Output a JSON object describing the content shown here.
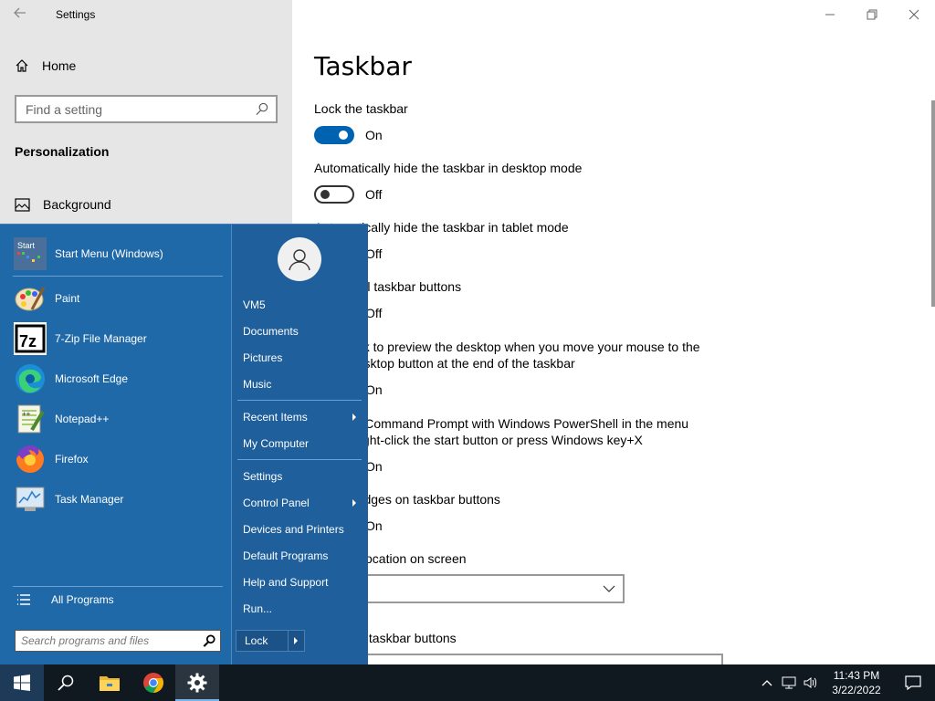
{
  "window": {
    "title": "Settings",
    "controls": {
      "minimize": "minimize",
      "maximize": "maximize",
      "close": "close"
    }
  },
  "sidebar": {
    "home_label": "Home",
    "search_placeholder": "Find a setting",
    "section_title": "Personalization",
    "items": [
      {
        "label": "Background",
        "icon": "picture-icon"
      }
    ]
  },
  "content": {
    "page_title": "Taskbar",
    "settings": [
      {
        "label": "Lock the taskbar",
        "state": "On"
      },
      {
        "label": "Automatically hide the taskbar in desktop mode",
        "state": "Off"
      },
      {
        "label": "Automatically hide the taskbar in tablet mode",
        "state": "Off"
      },
      {
        "label": "Use small taskbar buttons",
        "state": "Off"
      },
      {
        "label": "Use Peek to preview the desktop when you move your mouse to the Show desktop button at the end of the taskbar",
        "state": "On"
      },
      {
        "label": "Replace Command Prompt with Windows PowerShell in the menu when I right-click the start button or press Windows key+X",
        "state": "On"
      },
      {
        "label": "Show badges on taskbar buttons",
        "state": "On"
      },
      {
        "label": "Taskbar location on screen",
        "value": ""
      },
      {
        "label": "Combine taskbar buttons",
        "value": ""
      }
    ]
  },
  "start_menu": {
    "pinned": [
      {
        "label": "Start Menu (Windows)",
        "icon": "start-menu-app-icon"
      },
      {
        "label": "Paint",
        "icon": "paint-icon"
      },
      {
        "label": "7-Zip File Manager",
        "icon": "7zip-icon"
      },
      {
        "label": "Microsoft Edge",
        "icon": "edge-icon"
      },
      {
        "label": "Notepad++",
        "icon": "notepadpp-icon"
      },
      {
        "label": "Firefox",
        "icon": "firefox-icon"
      },
      {
        "label": "Task Manager",
        "icon": "task-manager-icon"
      }
    ],
    "all_programs": "All Programs",
    "search_placeholder": "Search programs and files",
    "right_items": [
      {
        "label": "VM5"
      },
      {
        "label": "Documents"
      },
      {
        "label": "Pictures"
      },
      {
        "label": "Music"
      },
      {
        "label": "Recent Items",
        "submenu": true
      },
      {
        "label": "My Computer"
      },
      {
        "label": "Settings"
      },
      {
        "label": "Control Panel",
        "submenu": true
      },
      {
        "label": "Devices and Printers"
      },
      {
        "label": "Default Programs"
      },
      {
        "label": "Help and Support"
      },
      {
        "label": "Run..."
      }
    ],
    "lock_label": "Lock"
  },
  "taskbar": {
    "time": "11:43 PM",
    "date": "3/22/2022",
    "pinned_icons": [
      "windows-start-icon",
      "search-icon",
      "file-explorer-icon",
      "chrome-icon",
      "settings-gear-icon"
    ]
  },
  "colors": {
    "accent": "#0063b1",
    "start_menu_bg": "#1f5f9b",
    "start_menu_left": "#2069a8",
    "taskbar_bg": "#101820"
  }
}
